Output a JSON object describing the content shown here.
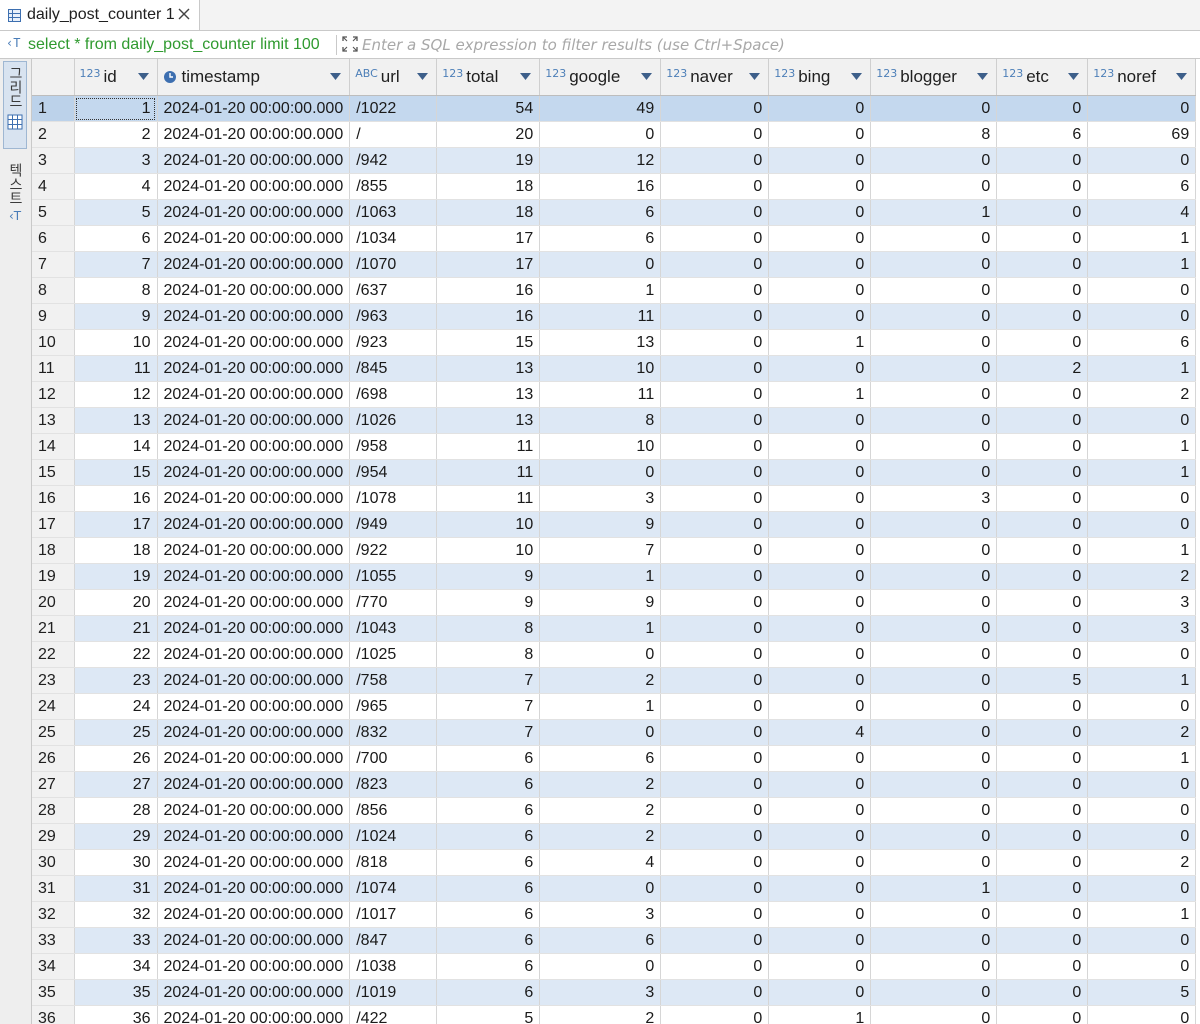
{
  "tab": {
    "title": "daily_post_counter 1"
  },
  "filter": {
    "query": "select * from daily_post_counter limit 100",
    "placeholder": "Enter a SQL expression to filter results (use Ctrl+Space)"
  },
  "views": {
    "grid_label": "그리드",
    "text_label": "텍스트"
  },
  "columns": [
    {
      "name": "id",
      "type": "123",
      "align": "num",
      "width": 83
    },
    {
      "name": "timestamp",
      "type": "clock",
      "align": "txt",
      "width": 189
    },
    {
      "name": "url",
      "type": "ABC",
      "align": "txt",
      "width": 87
    },
    {
      "name": "total",
      "type": "123",
      "align": "num",
      "width": 103
    },
    {
      "name": "google",
      "type": "123",
      "align": "num",
      "width": 121
    },
    {
      "name": "naver",
      "type": "123",
      "align": "num",
      "width": 108
    },
    {
      "name": "bing",
      "type": "123",
      "align": "num",
      "width": 102
    },
    {
      "name": "blogger",
      "type": "123",
      "align": "num",
      "width": 126
    },
    {
      "name": "etc",
      "type": "123",
      "align": "num",
      "width": 91
    },
    {
      "name": "noref",
      "type": "123",
      "align": "num",
      "width": 108
    }
  ],
  "rows": [
    [
      "1",
      "2024-01-20 00:00:00.000",
      "/1022",
      "54",
      "49",
      "0",
      "0",
      "0",
      "0",
      "0"
    ],
    [
      "2",
      "2024-01-20 00:00:00.000",
      "/",
      "20",
      "0",
      "0",
      "0",
      "8",
      "6",
      "69"
    ],
    [
      "3",
      "2024-01-20 00:00:00.000",
      "/942",
      "19",
      "12",
      "0",
      "0",
      "0",
      "0",
      "0"
    ],
    [
      "4",
      "2024-01-20 00:00:00.000",
      "/855",
      "18",
      "16",
      "0",
      "0",
      "0",
      "0",
      "6"
    ],
    [
      "5",
      "2024-01-20 00:00:00.000",
      "/1063",
      "18",
      "6",
      "0",
      "0",
      "1",
      "0",
      "4"
    ],
    [
      "6",
      "2024-01-20 00:00:00.000",
      "/1034",
      "17",
      "6",
      "0",
      "0",
      "0",
      "0",
      "1"
    ],
    [
      "7",
      "2024-01-20 00:00:00.000",
      "/1070",
      "17",
      "0",
      "0",
      "0",
      "0",
      "0",
      "1"
    ],
    [
      "8",
      "2024-01-20 00:00:00.000",
      "/637",
      "16",
      "1",
      "0",
      "0",
      "0",
      "0",
      "0"
    ],
    [
      "9",
      "2024-01-20 00:00:00.000",
      "/963",
      "16",
      "11",
      "0",
      "0",
      "0",
      "0",
      "0"
    ],
    [
      "10",
      "2024-01-20 00:00:00.000",
      "/923",
      "15",
      "13",
      "0",
      "1",
      "0",
      "0",
      "6"
    ],
    [
      "11",
      "2024-01-20 00:00:00.000",
      "/845",
      "13",
      "10",
      "0",
      "0",
      "0",
      "2",
      "1"
    ],
    [
      "12",
      "2024-01-20 00:00:00.000",
      "/698",
      "13",
      "11",
      "0",
      "1",
      "0",
      "0",
      "2"
    ],
    [
      "13",
      "2024-01-20 00:00:00.000",
      "/1026",
      "13",
      "8",
      "0",
      "0",
      "0",
      "0",
      "0"
    ],
    [
      "14",
      "2024-01-20 00:00:00.000",
      "/958",
      "11",
      "10",
      "0",
      "0",
      "0",
      "0",
      "1"
    ],
    [
      "15",
      "2024-01-20 00:00:00.000",
      "/954",
      "11",
      "0",
      "0",
      "0",
      "0",
      "0",
      "1"
    ],
    [
      "16",
      "2024-01-20 00:00:00.000",
      "/1078",
      "11",
      "3",
      "0",
      "0",
      "3",
      "0",
      "0"
    ],
    [
      "17",
      "2024-01-20 00:00:00.000",
      "/949",
      "10",
      "9",
      "0",
      "0",
      "0",
      "0",
      "0"
    ],
    [
      "18",
      "2024-01-20 00:00:00.000",
      "/922",
      "10",
      "7",
      "0",
      "0",
      "0",
      "0",
      "1"
    ],
    [
      "19",
      "2024-01-20 00:00:00.000",
      "/1055",
      "9",
      "1",
      "0",
      "0",
      "0",
      "0",
      "2"
    ],
    [
      "20",
      "2024-01-20 00:00:00.000",
      "/770",
      "9",
      "9",
      "0",
      "0",
      "0",
      "0",
      "3"
    ],
    [
      "21",
      "2024-01-20 00:00:00.000",
      "/1043",
      "8",
      "1",
      "0",
      "0",
      "0",
      "0",
      "3"
    ],
    [
      "22",
      "2024-01-20 00:00:00.000",
      "/1025",
      "8",
      "0",
      "0",
      "0",
      "0",
      "0",
      "0"
    ],
    [
      "23",
      "2024-01-20 00:00:00.000",
      "/758",
      "7",
      "2",
      "0",
      "0",
      "0",
      "5",
      "1"
    ],
    [
      "24",
      "2024-01-20 00:00:00.000",
      "/965",
      "7",
      "1",
      "0",
      "0",
      "0",
      "0",
      "0"
    ],
    [
      "25",
      "2024-01-20 00:00:00.000",
      "/832",
      "7",
      "0",
      "0",
      "4",
      "0",
      "0",
      "2"
    ],
    [
      "26",
      "2024-01-20 00:00:00.000",
      "/700",
      "6",
      "6",
      "0",
      "0",
      "0",
      "0",
      "1"
    ],
    [
      "27",
      "2024-01-20 00:00:00.000",
      "/823",
      "6",
      "2",
      "0",
      "0",
      "0",
      "0",
      "0"
    ],
    [
      "28",
      "2024-01-20 00:00:00.000",
      "/856",
      "6",
      "2",
      "0",
      "0",
      "0",
      "0",
      "0"
    ],
    [
      "29",
      "2024-01-20 00:00:00.000",
      "/1024",
      "6",
      "2",
      "0",
      "0",
      "0",
      "0",
      "0"
    ],
    [
      "30",
      "2024-01-20 00:00:00.000",
      "/818",
      "6",
      "4",
      "0",
      "0",
      "0",
      "0",
      "2"
    ],
    [
      "31",
      "2024-01-20 00:00:00.000",
      "/1074",
      "6",
      "0",
      "0",
      "0",
      "1",
      "0",
      "0"
    ],
    [
      "32",
      "2024-01-20 00:00:00.000",
      "/1017",
      "6",
      "3",
      "0",
      "0",
      "0",
      "0",
      "1"
    ],
    [
      "33",
      "2024-01-20 00:00:00.000",
      "/847",
      "6",
      "6",
      "0",
      "0",
      "0",
      "0",
      "0"
    ],
    [
      "34",
      "2024-01-20 00:00:00.000",
      "/1038",
      "6",
      "0",
      "0",
      "0",
      "0",
      "0",
      "0"
    ],
    [
      "35",
      "2024-01-20 00:00:00.000",
      "/1019",
      "6",
      "3",
      "0",
      "0",
      "0",
      "0",
      "5"
    ],
    [
      "36",
      "2024-01-20 00:00:00.000",
      "/422",
      "5",
      "2",
      "0",
      "1",
      "0",
      "0",
      "0"
    ]
  ],
  "row_numbers": [
    "1",
    "2",
    "3",
    "4",
    "5",
    "6",
    "7",
    "8",
    "9",
    "10",
    "11",
    "12",
    "13",
    "14",
    "15",
    "16",
    "17",
    "18",
    "19",
    "20",
    "21",
    "22",
    "23",
    "24",
    "25",
    "26",
    "27",
    "28",
    "29",
    "30",
    "31",
    "32",
    "33",
    "34",
    "35",
    "36"
  ],
  "selected_row": 1,
  "colors": {
    "accent": "#4a7db8",
    "query_green": "#2f9a2f",
    "row_alt": "#dde8f5",
    "row_selected": "#c4d8ee"
  }
}
